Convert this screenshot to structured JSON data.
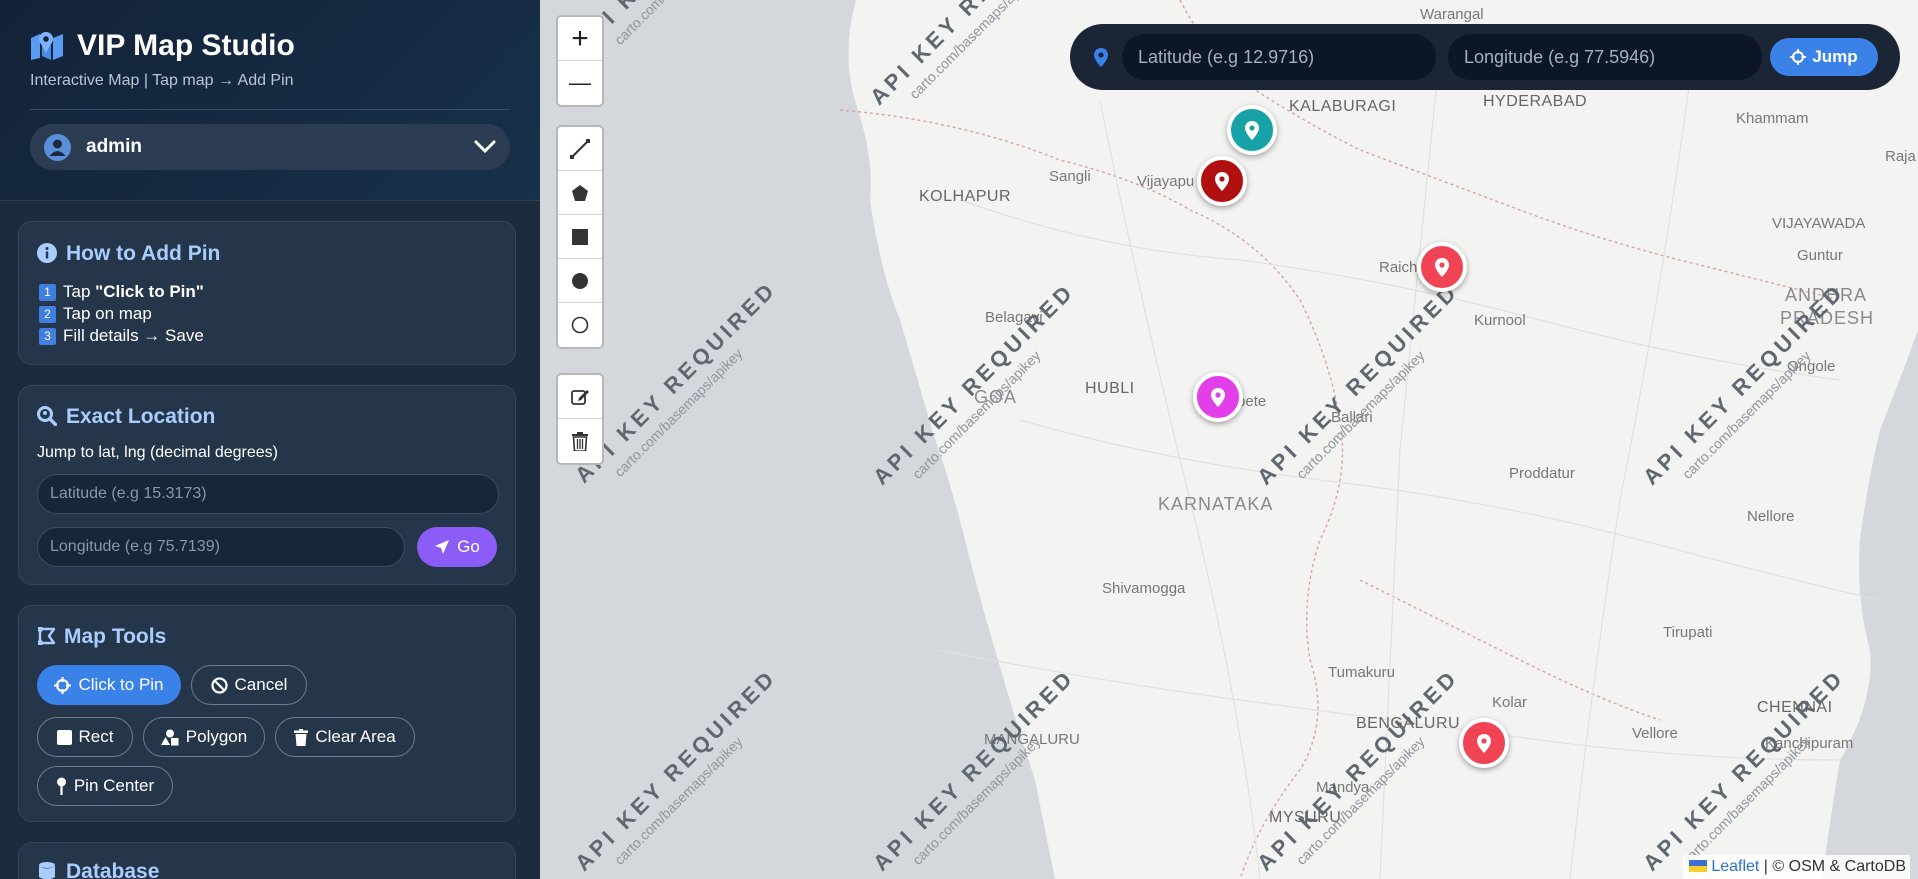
{
  "app": {
    "title": "VIP Map Studio",
    "subtitle": "Interactive Map | Tap map → Add Pin",
    "user": "admin"
  },
  "how_to": {
    "title": "How to Add Pin",
    "steps": [
      {
        "num": "1",
        "prefix": "Tap ",
        "bold": "\"Click to Pin\""
      },
      {
        "num": "2",
        "text": "Tap on map"
      },
      {
        "num": "3",
        "text": "Fill details → Save"
      }
    ]
  },
  "exact_location": {
    "title": "Exact Location",
    "hint": "Jump to lat, lng (decimal degrees)",
    "lat_placeholder": "Latitude (e.g 15.3173)",
    "lng_placeholder": "Longitude (e.g 75.7139)",
    "go_label": "Go"
  },
  "map_tools": {
    "title": "Map Tools",
    "click_to_pin": "Click to Pin",
    "cancel": "Cancel",
    "rect": "Rect",
    "polygon": "Polygon",
    "clear_area": "Clear Area",
    "pin_center": "Pin Center"
  },
  "database": {
    "title": "Database"
  },
  "jumpbar": {
    "lat_placeholder": "Latitude (e.g 12.9716)",
    "lng_placeholder": "Longitude (e.g 77.5946)",
    "jump_label": "Jump"
  },
  "map": {
    "zoom_in": "+",
    "zoom_out": "—",
    "watermark_title": "API KEY REQUIRED",
    "watermark_url": "carto.com/basemaps/apikey",
    "places": {
      "warangal": "Warangal",
      "hyderabad": "HYDERABAD",
      "kalaburagi": "KALABURAGI",
      "khammam": "Khammam",
      "sangli": "Sangli",
      "vijayapura": "Vijayapu",
      "kolhapur": "KOLHAPUR",
      "vijayawada": "VIJAYAWADA",
      "guntur": "Guntur",
      "raichur": "Raich",
      "andhra1": "ANDHRA",
      "andhra2": "PRADESH",
      "belagavi": "Belagavi",
      "kurnool": "Kurnool",
      "ongole": "Ongole",
      "goa": "GOA",
      "hubli": "HUBLI",
      "hosapete": "Hosapete",
      "ballari": "Ballari",
      "karnataka": "KARNATAKA",
      "proddatur": "Proddatur",
      "nellore": "Nellore",
      "shivamogga": "Shivamogga",
      "tirupati": "Tirupati",
      "tumakuru": "Tumakuru",
      "bengaluru": "BENGALURU",
      "kolar": "Kolar",
      "chennai": "CHENNAI",
      "mangaluru": "MANGALURU",
      "vellore": "Vellore",
      "kanchipuram": "Kanchipuram",
      "mandya": "Mandya",
      "mysuru": "MYSURU",
      "raja": "Raja"
    },
    "attribution_link": "Leaflet",
    "attribution_text": " | © OSM & CartoDB"
  },
  "colors": {
    "marker_teal": "#17a2a8",
    "marker_darkred": "#b01010",
    "marker_red": "#f04455",
    "marker_magenta": "#e23fe8",
    "accent_blue": "#3a82e8",
    "accent_purple": "#8b5cf6"
  }
}
